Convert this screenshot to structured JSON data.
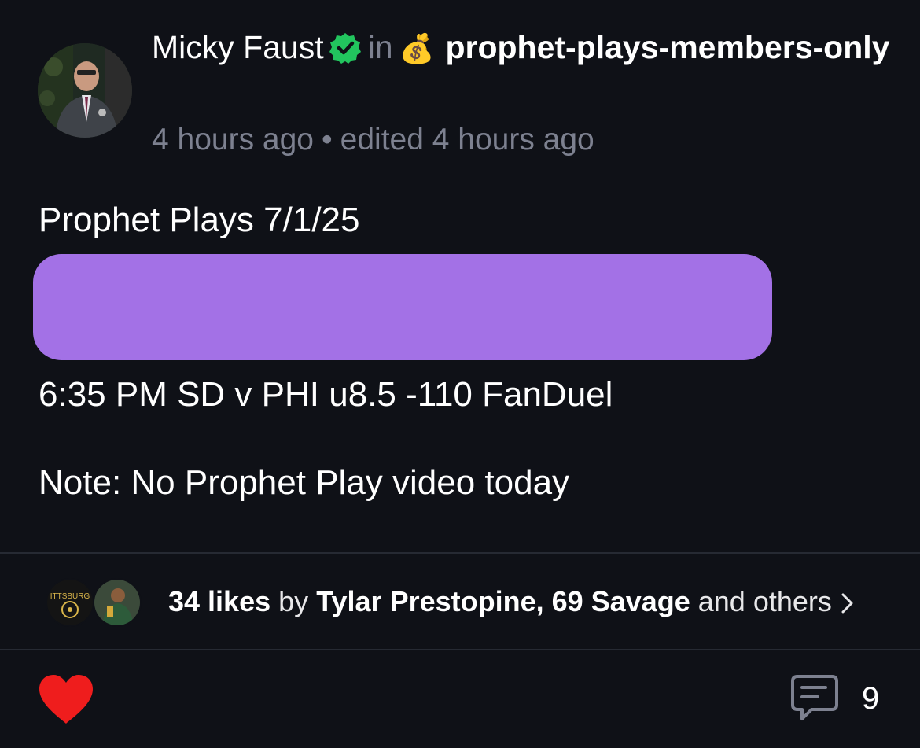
{
  "post": {
    "author": "Micky Faust",
    "in_label": "in",
    "community_emoji": "💰",
    "community": "prophet-plays-members-only",
    "time": "4 hours ago",
    "separator": "•",
    "edited": "edited 4 hours ago",
    "title": "Prophet Plays 7/1/25",
    "play": "6:35 PM SD v PHI u8.5 -110 FanDuel",
    "note": "Note: No Prophet Play video today",
    "spoiler_color": "#a371e6"
  },
  "likes": {
    "count_label": "34 likes",
    "by_label": "by",
    "names": "Tylar Prestopine, 69 Savage",
    "others_label": "and others"
  },
  "actions": {
    "comment_count": "9",
    "like_icon": "heart-icon",
    "comment_icon": "comment-icon"
  },
  "colors": {
    "background": "#0f1117",
    "muted_text": "#7d8190",
    "verified": "#22c55e",
    "heart": "#ef1d1d"
  }
}
